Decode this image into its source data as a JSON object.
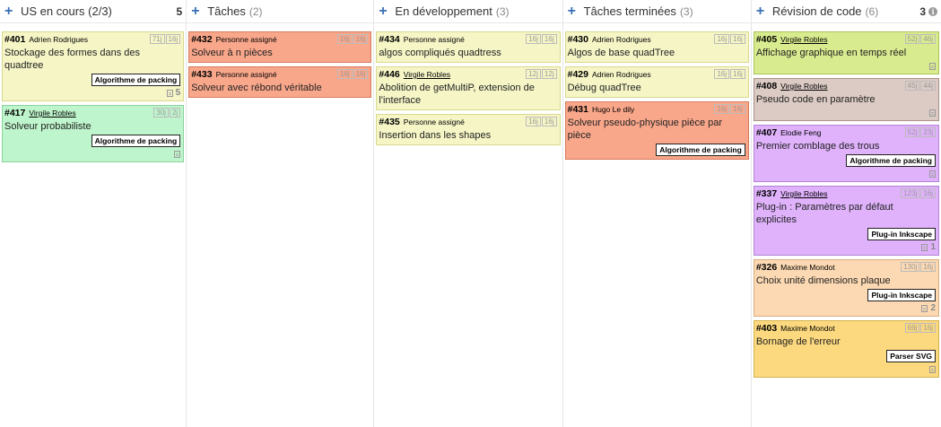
{
  "columns": [
    {
      "title": "US en cours (2/3)",
      "count": "",
      "limit": "5",
      "info": false,
      "cards": [
        {
          "id": "#401",
          "owner": "Adrien Rodrigues",
          "owner_link": false,
          "est1": "71j",
          "est2": "16j",
          "title": "Stockage des formes dans des quadtree",
          "tag": "Algorithme de packing",
          "doc": true,
          "doc_count": "5",
          "color": "yellow"
        },
        {
          "id": "#417",
          "owner": "Virgile Robles",
          "owner_link": true,
          "est1": "30j",
          "est2": "2j",
          "title": "Solveur probabiliste",
          "tag": "Algorithme de packing",
          "doc": true,
          "doc_count": "",
          "color": "green"
        }
      ]
    },
    {
      "title": "Tâches",
      "count": "(2)",
      "limit": "",
      "info": false,
      "cards": [
        {
          "id": "#432",
          "owner": "Personne assigné",
          "owner_link": false,
          "est1": "16j",
          "est2": "16j",
          "title": "Solveur à n pièces",
          "tag": "",
          "doc": false,
          "doc_count": "",
          "color": "red"
        },
        {
          "id": "#433",
          "owner": "Personne assigné",
          "owner_link": false,
          "est1": "16j",
          "est2": "16j",
          "title": "Solveur avec rébond véritable",
          "tag": "",
          "doc": false,
          "doc_count": "",
          "color": "red"
        }
      ]
    },
    {
      "title": "En développement",
      "count": "(3)",
      "limit": "",
      "info": false,
      "cards": [
        {
          "id": "#434",
          "owner": "Personne assigné",
          "owner_link": false,
          "est1": "16j",
          "est2": "16j",
          "title": "algos compliqués quadtress",
          "tag": "",
          "doc": false,
          "doc_count": "",
          "color": "yellow"
        },
        {
          "id": "#446",
          "owner": "Virgile Robles",
          "owner_link": true,
          "est1": "12j",
          "est2": "12j",
          "title": "Abolition de getMultiP, extension de l'interface",
          "tag": "",
          "doc": false,
          "doc_count": "",
          "color": "yellow"
        },
        {
          "id": "#435",
          "owner": "Personne assigné",
          "owner_link": false,
          "est1": "16j",
          "est2": "16j",
          "title": "Insertion dans les shapes",
          "tag": "",
          "doc": false,
          "doc_count": "",
          "color": "yellow"
        }
      ]
    },
    {
      "title": "Tâches terminées",
      "count": "(3)",
      "limit": "",
      "info": false,
      "cards": [
        {
          "id": "#430",
          "owner": "Adrien Rodrigues",
          "owner_link": false,
          "est1": "16j",
          "est2": "16j",
          "title": "Algos de base quadTree",
          "tag": "",
          "doc": false,
          "doc_count": "",
          "color": "yellow"
        },
        {
          "id": "#429",
          "owner": "Adrien Rodrigues",
          "owner_link": false,
          "est1": "16j",
          "est2": "16j",
          "title": "Débug quadTree",
          "tag": "",
          "doc": false,
          "doc_count": "",
          "color": "yellow"
        },
        {
          "id": "#431",
          "owner": "Hugo Le dily",
          "owner_link": false,
          "est1": "16j",
          "est2": "16j",
          "title": "Solveur pseudo-physique pièce par pièce",
          "tag": "Algorithme de packing",
          "doc": false,
          "doc_count": "",
          "color": "red"
        }
      ]
    },
    {
      "title": "Révision de code",
      "count": "(6)",
      "limit": "3",
      "info": true,
      "cards": [
        {
          "id": "#405",
          "owner": "Virgile Robles",
          "owner_link": true,
          "est1": "52j",
          "est2": "46j",
          "title": "Affichage graphique en temps réel",
          "tag": "",
          "doc": true,
          "doc_count": "",
          "color": "lime"
        },
        {
          "id": "#408",
          "owner": "Virgile Robles",
          "owner_link": true,
          "est1": "45j",
          "est2": "44j",
          "title": "Pseudo code en paramètre",
          "tag": "",
          "doc": true,
          "doc_count": "",
          "color": "rose"
        },
        {
          "id": "#407",
          "owner": "Elodie Feng",
          "owner_link": false,
          "est1": "52j",
          "est2": "23j",
          "title": "Premier comblage des trous",
          "tag": "Algorithme de packing",
          "doc": true,
          "doc_count": "",
          "color": "violet"
        },
        {
          "id": "#337",
          "owner": "Virgile Robles",
          "owner_link": true,
          "est1": "123j",
          "est2": "16j",
          "title": "Plug-in : Paramètres par défaut explicites",
          "tag": "Plug-in Inkscape",
          "doc": true,
          "doc_count": "1",
          "color": "violet"
        },
        {
          "id": "#326",
          "owner": "Maxime Mondot",
          "owner_link": false,
          "est1": "130j",
          "est2": "16j",
          "title": "Choix unité dimensions plaque",
          "tag": "Plug-in Inkscape",
          "doc": true,
          "doc_count": "2",
          "color": "peach"
        },
        {
          "id": "#403",
          "owner": "Maxime Mondot",
          "owner_link": false,
          "est1": "69j",
          "est2": "16j",
          "title": "Bornage de l'erreur",
          "tag": "Parser SVG",
          "doc": true,
          "doc_count": "",
          "color": "gold"
        }
      ]
    }
  ]
}
